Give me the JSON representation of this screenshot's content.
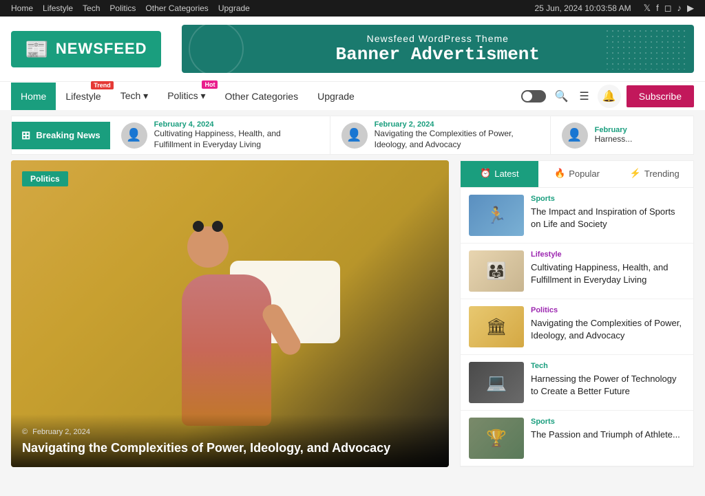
{
  "topbar": {
    "nav_links": [
      "Home",
      "Lifestyle",
      "Tech",
      "Politics",
      "Other Categories",
      "Upgrade"
    ],
    "datetime": "25 Jun, 2024 10:03:58 AM",
    "social_icons": [
      "𝕏",
      "f",
      "◻",
      "♪",
      "▶"
    ]
  },
  "header": {
    "logo_text": "NEWSFEED",
    "logo_icon": "📰",
    "ad_title": "Newsfeed WordPress Theme",
    "ad_subtitle": "Banner Advertisment"
  },
  "main_nav": {
    "items": [
      {
        "label": "Home",
        "active": true,
        "badge": null
      },
      {
        "label": "Lifestyle",
        "active": false,
        "badge": null
      },
      {
        "label": "Tech",
        "active": false,
        "badge": "▾",
        "badge_type": "dropdown"
      },
      {
        "label": "Politics",
        "active": false,
        "badge": null,
        "badge_type": "dropdown"
      },
      {
        "label": "Other Categories",
        "active": false,
        "badge": null
      },
      {
        "label": "Upgrade",
        "active": false,
        "badge": null
      }
    ],
    "trend_badge": "Trend",
    "hot_badge": "Hot",
    "subscribe_label": "Subscribe"
  },
  "breaking_news": {
    "label": "Breaking News",
    "items": [
      {
        "date": "February 4, 2024",
        "title": "Cultivating Happiness, Health, and Fulfillment in Everyday Living",
        "avatar": "👤"
      },
      {
        "date": "February 2, 2024",
        "title": "Navigating the Complexities of Power, Ideology, and Advocacy",
        "avatar": "👤"
      },
      {
        "date": "February",
        "title": "Harness...",
        "avatar": "👤"
      }
    ]
  },
  "featured": {
    "category": "Politics",
    "date": "February 2, 2024",
    "title": "Navigating the Complexities of Power, Ideology, and Advocacy"
  },
  "sidebar": {
    "tabs": [
      {
        "label": "Latest",
        "icon": "⏰",
        "active": true
      },
      {
        "label": "Popular",
        "icon": "🔥",
        "active": false
      },
      {
        "label": "Trending",
        "icon": "⚡",
        "active": false
      }
    ],
    "articles": [
      {
        "category": "Sports",
        "cat_class": "cat-sports",
        "thumb_class": "thumb-sports",
        "title": "The Impact and Inspiration of Sports on Life and Society",
        "thumb_icon": "🏃"
      },
      {
        "category": "Lifestyle",
        "cat_class": "cat-lifestyle",
        "thumb_class": "thumb-lifestyle",
        "title": "Cultivating Happiness, Health, and Fulfillment in Everyday Living",
        "thumb_icon": "👨‍👩‍👧"
      },
      {
        "category": "Politics",
        "cat_class": "cat-politics",
        "thumb_class": "thumb-politics",
        "title": "Navigating the Complexities of Power, Ideology, and Advocacy",
        "thumb_icon": "🏛"
      },
      {
        "category": "Tech",
        "cat_class": "cat-tech",
        "thumb_class": "thumb-tech",
        "title": "Harnessing the Power of Technology to Create a Better Future",
        "thumb_icon": "💻"
      },
      {
        "category": "Sports",
        "cat_class": "cat-sports",
        "thumb_class": "thumb-sports2",
        "title": "The Passion and Triumph of Athlete...",
        "thumb_icon": "🏆"
      }
    ]
  }
}
